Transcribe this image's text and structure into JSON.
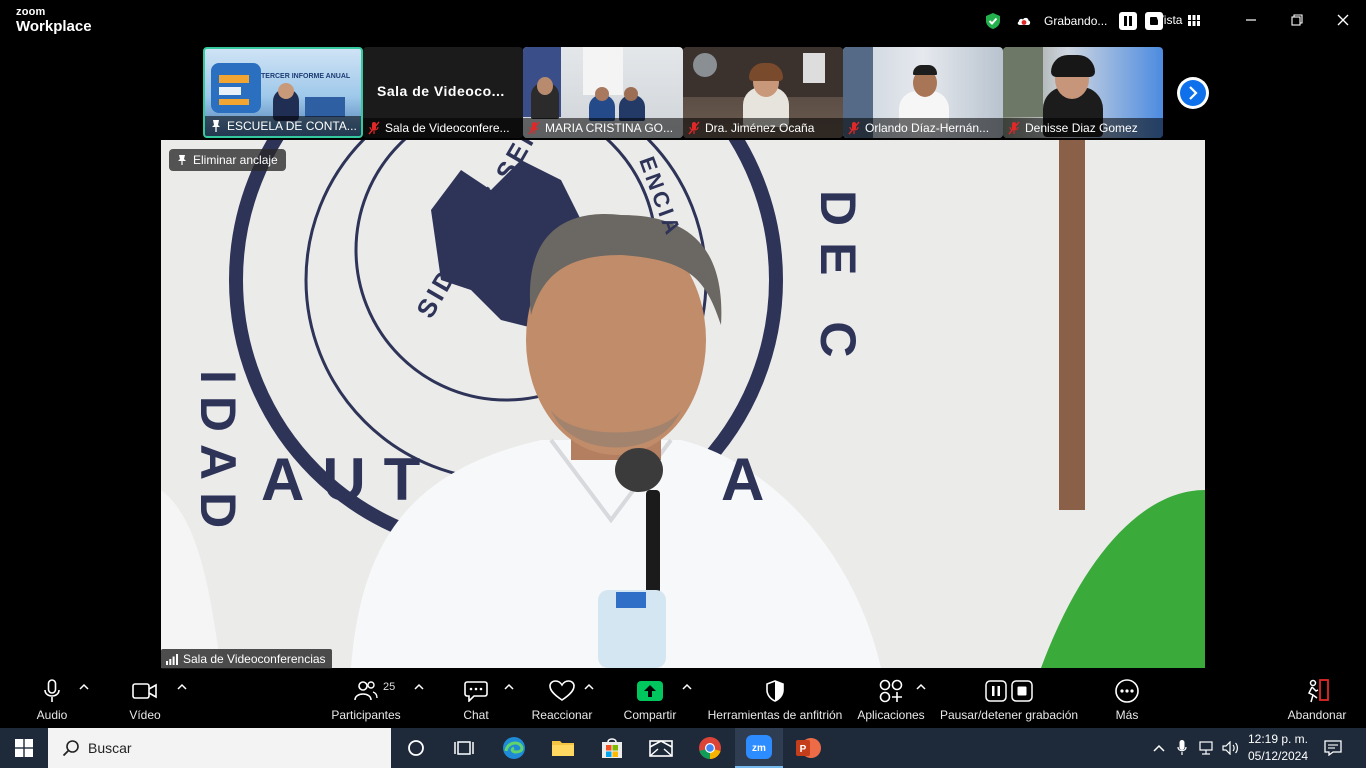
{
  "app": {
    "logo_small": "zoom",
    "logo_big": "Workplace",
    "recording_label": "Grabando...",
    "view_label": "Vista"
  },
  "thumbnails": [
    {
      "name": "ESCUELA DE CONTA...",
      "banner_text": "TERCER INFORME ANUAL",
      "pinned": true,
      "active": true
    },
    {
      "name": "Sala de Videoconfere...",
      "title_text": "Sala  de  Videoco...",
      "muted": true
    },
    {
      "name": "MARIA CRISTINA GO...",
      "muted": true
    },
    {
      "name": "Dra. Jiménez Ocaña",
      "muted": true
    },
    {
      "name": "Orlando Díaz-Hernán...",
      "muted": true
    },
    {
      "name": "Denisse Diaz Gomez",
      "muted": true
    }
  ],
  "main_video": {
    "unpin_label": "Eliminar anclaje",
    "speaker_label": "Sala de Videoconferencias",
    "background_text": {
      "seal_text": "SIDAD DE SERVIR",
      "seal_text_right": "ENCIA",
      "side_left": "IDAD",
      "side_right": "DE C",
      "bottom": "AUT",
      "bottom_right": "A"
    }
  },
  "toolbar": {
    "audio": "Audio",
    "video": "Vídeo",
    "participants": "Participantes",
    "participants_count": "25",
    "chat": "Chat",
    "react": "Reaccionar",
    "share": "Compartir",
    "host_tools": "Herramientas de anfitrión",
    "apps": "Aplicaciones",
    "pause_recording": "Pausar/detener grabación",
    "more": "Más",
    "leave": "Abandonar"
  },
  "taskbar": {
    "search_placeholder": "Buscar",
    "time": "12:19 p. m.",
    "date": "05/12/2024"
  },
  "colors": {
    "active_thumb_border": "#35c9a0",
    "share_green": "#00c65e",
    "leave_red": "#e02828",
    "nav_blue": "#0e71eb",
    "security_green": "#23b14d"
  }
}
